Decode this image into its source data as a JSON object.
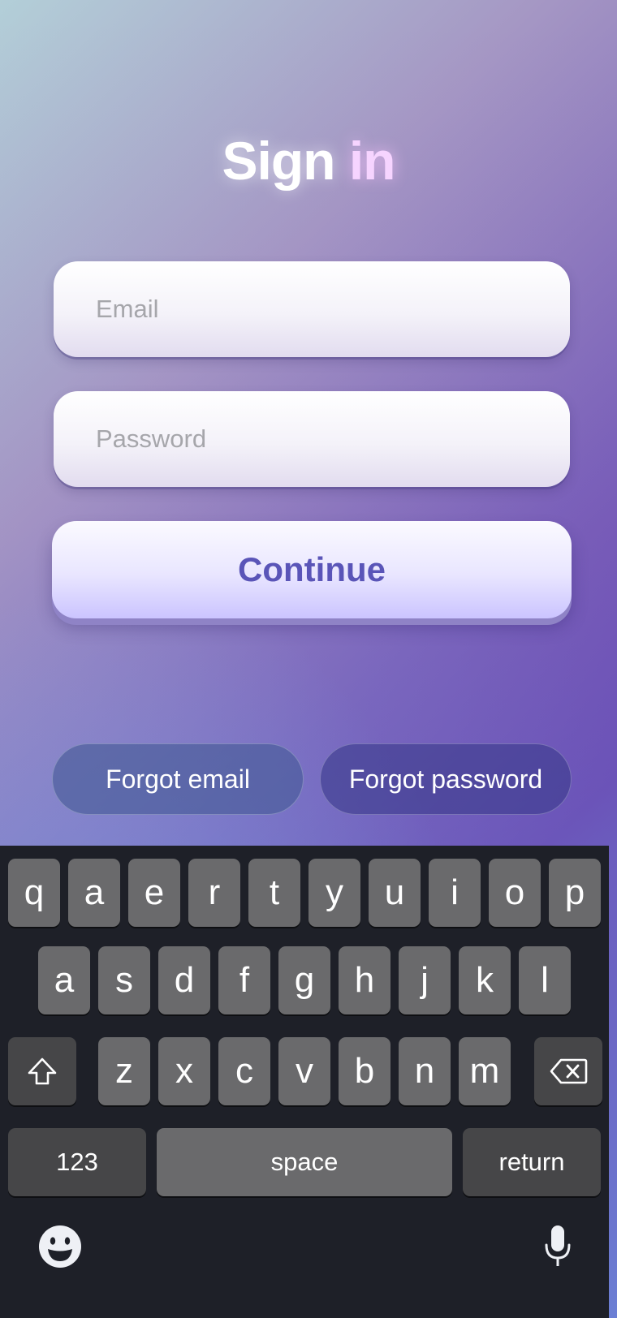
{
  "title": {
    "main": "Sign",
    "accent": "in"
  },
  "form": {
    "email_placeholder": "Email",
    "password_placeholder": "Password",
    "continue_label": "Continue"
  },
  "links": {
    "forgot_email": "Forgot email",
    "forgot_password": "Forgot password"
  },
  "keyboard": {
    "row1": [
      "q",
      "a",
      "e",
      "r",
      "t",
      "y",
      "u",
      "i",
      "o",
      "p"
    ],
    "row2": [
      "a",
      "s",
      "d",
      "f",
      "g",
      "h",
      "j",
      "k",
      "l"
    ],
    "row3": [
      "z",
      "x",
      "c",
      "v",
      "b",
      "n",
      "m"
    ],
    "numbers_label": "123",
    "space_label": "space",
    "return_label": "return",
    "shift_icon": "shift-icon",
    "backspace_icon": "backspace-icon",
    "emoji_icon": "emoji-icon",
    "mic_icon": "microphone-icon"
  },
  "colors": {
    "continue_text": "#5a55b8",
    "title_accent": "#f6d4ff",
    "keyboard_bg": "#1e2028",
    "key_bg": "#6a6a6c",
    "key_dark_bg": "#464648"
  }
}
